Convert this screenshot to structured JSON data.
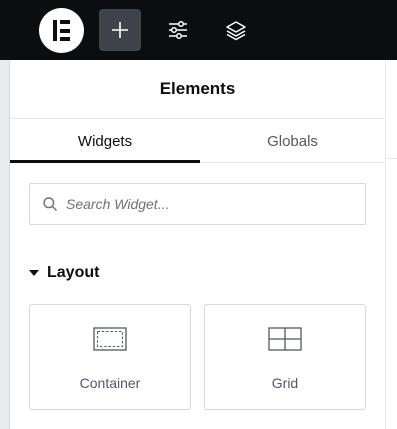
{
  "topbar": {
    "logo_icon": "elementor-logo-icon",
    "buttons": [
      {
        "name": "add-element-button",
        "icon": "plus-icon",
        "active": true
      },
      {
        "name": "site-settings-button",
        "icon": "sliders-icon",
        "active": false
      },
      {
        "name": "structure-button",
        "icon": "layers-icon",
        "active": false
      }
    ]
  },
  "panel": {
    "title": "Elements",
    "tabs": [
      {
        "label": "Widgets",
        "active": true
      },
      {
        "label": "Globals",
        "active": false
      }
    ],
    "search": {
      "placeholder": "Search Widget...",
      "value": "",
      "icon": "search-icon"
    },
    "sections": [
      {
        "title": "Layout",
        "expanded": true,
        "widgets": [
          {
            "label": "Container",
            "icon": "container-icon"
          },
          {
            "label": "Grid",
            "icon": "grid-icon"
          }
        ]
      }
    ]
  },
  "colors": {
    "topbar_bg": "#0c0d0e",
    "active_button_bg": "#3f444b",
    "text_primary": "#0c0d0e",
    "text_secondary": "#515962",
    "border": "#d5d8dc"
  }
}
